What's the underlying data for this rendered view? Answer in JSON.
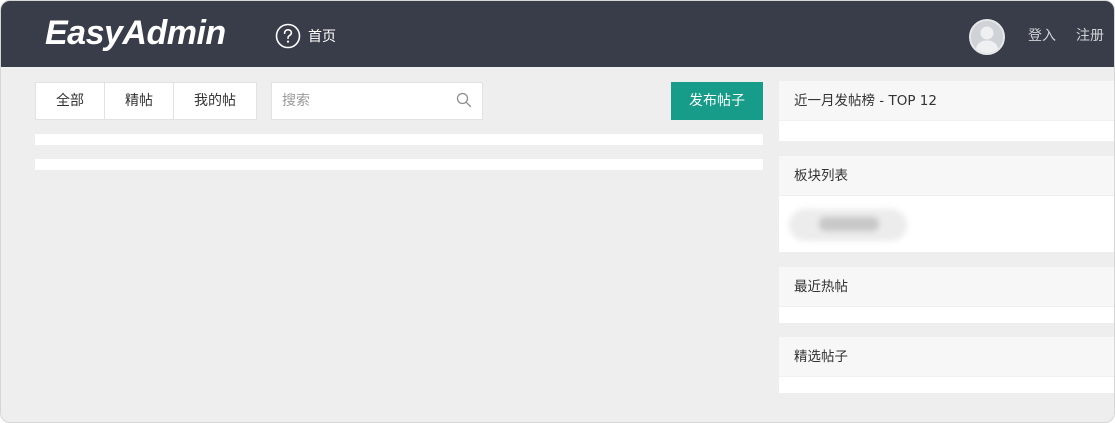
{
  "header": {
    "logo": "EasyAdmin",
    "home_label": "首页",
    "login_label": "登入",
    "register_label": "注册"
  },
  "toolbar": {
    "tabs": [
      {
        "label": "全部"
      },
      {
        "label": "精帖"
      },
      {
        "label": "我的帖"
      }
    ],
    "search_placeholder": "搜索",
    "publish_label": "发布帖子"
  },
  "sidebar": {
    "panels": [
      {
        "title": "近一月发帖榜 - TOP 12"
      },
      {
        "title": "板块列表"
      },
      {
        "title": "最近热帖"
      },
      {
        "title": "精选帖子"
      }
    ]
  },
  "colors": {
    "header_bg": "#393d49",
    "accent": "#169c88",
    "page_bg": "#eeeeee"
  },
  "icons": {
    "home": "help-circle-icon",
    "search": "search-icon",
    "avatar": "user-avatar-icon"
  }
}
